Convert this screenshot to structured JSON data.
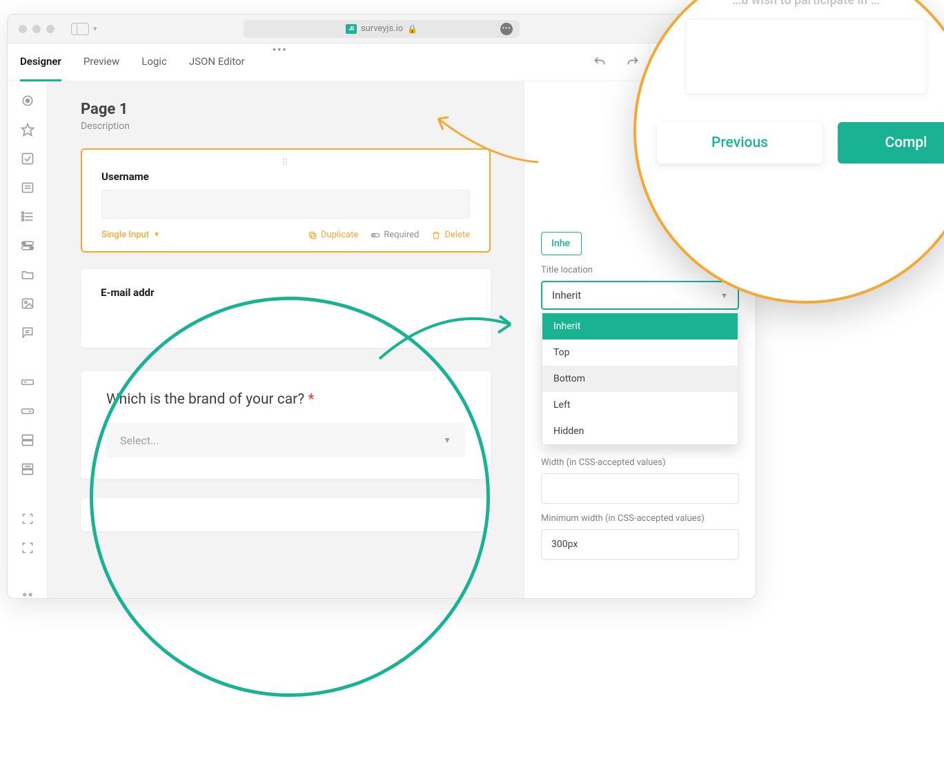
{
  "browser": {
    "url": "surveyjs.io",
    "favicon_label": "JS"
  },
  "tabs": {
    "designer": "Designer",
    "preview": "Preview",
    "logic": "Logic",
    "json": "JSON Editor"
  },
  "page": {
    "title": "Page 1",
    "desc": "Description"
  },
  "q1": {
    "label": "Username",
    "type": "Single Input",
    "actions": {
      "duplicate": "Duplicate",
      "required": "Required",
      "delete": "Delete"
    }
  },
  "q2": {
    "label": "E-mail addr"
  },
  "q3": {
    "title": "Which is the brand of your car?",
    "required_marker": "*",
    "placeholder": "Select..."
  },
  "props": {
    "inherit_pill": "Inhe",
    "title_location_label": "Title location",
    "title_location_value": "Inherit",
    "title_location_options": [
      "Inherit",
      "Top",
      "Bottom",
      "Left",
      "Hidden"
    ],
    "title_location_highlight": "Bottom",
    "width_label": "Width (in CSS-accepted values)",
    "width_value": "",
    "min_width_label": "Minimum width (in CSS-accepted values)",
    "min_width_value": "300px"
  },
  "callout": {
    "ghost_text": "…u wish to participate in …",
    "prev": "Previous",
    "complete": "Compl"
  }
}
